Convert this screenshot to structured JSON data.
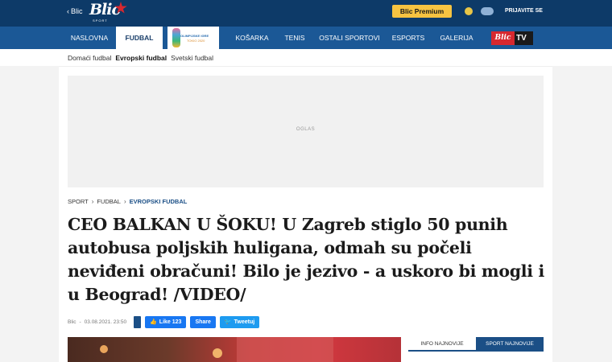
{
  "topbar": {
    "back_label": "Blic",
    "logo_text": "Blic",
    "logo_sub": "SPORT",
    "premium_label": "Blic Premium",
    "login_label": "PRIJAVITE SE"
  },
  "nav": {
    "items": [
      "NASLOVNA",
      "FUDBAL",
      "KOŠARKA",
      "TENIS",
      "OSTALI SPORTOVI",
      "ESPORTS",
      "GALERIJA"
    ],
    "olympics_line1": "OLIMPIJSKE IGRE",
    "olympics_line2": "TOKIO 2020",
    "tv_logo": "Blic",
    "tv_label": "TV"
  },
  "subnav": {
    "items": [
      "Domaći fudbal",
      "Evropski fudbal",
      "Svetski fudbal"
    ]
  },
  "ad": {
    "label": "OGLAS"
  },
  "breadcrumb": [
    "SPORT",
    "FUDBAL",
    "EVROPSKI FUDBAL"
  ],
  "article": {
    "title": "CEO BALKAN U ŠOKU! U Zagreb stiglo 50 punih autobusa poljskih huligana, odmah su počeli neviđeni obračuni! Bilo je jezivo - a uskoro bi mogli i u Beograd! /VIDEO/",
    "author": "Blic",
    "date": "03.08.2021. 23:50"
  },
  "share": {
    "like_label": "Like 123",
    "share_label": "Share",
    "tweet_label": "Tweetuj"
  },
  "sidebar_tabs": [
    "INFO NAJNOVIJE",
    "SPORT NAJNOVIJE"
  ],
  "colors": {
    "topbar": "#0d3a68",
    "navbar": "#1b5896",
    "brand_red": "#d7282f",
    "premium": "#f6c341",
    "accent_blue": "#1b4f86"
  }
}
